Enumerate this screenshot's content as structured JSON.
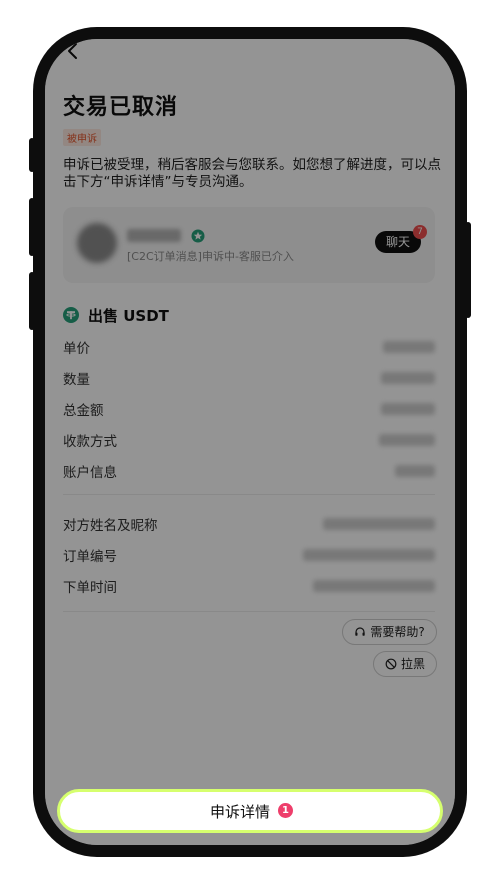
{
  "header": {
    "title": "交易已取消",
    "status_badge": "被申诉"
  },
  "description": "申诉已被受理，稍后客服会与您联系。如您想了解进度，可以点击下方“申诉详情”与专员沟通。",
  "chat_card": {
    "message_preview": "[C2C订单消息]申诉中-客服已介入",
    "chat_label": "聊天",
    "unread_count": "7"
  },
  "order": {
    "side_label": "出售 USDT",
    "fields": [
      {
        "label": "单价"
      },
      {
        "label": "数量"
      },
      {
        "label": "总金额"
      },
      {
        "label": "收款方式"
      },
      {
        "label": "账户信息"
      }
    ],
    "counterparty_fields": [
      {
        "label": "对方姓名及昵称"
      },
      {
        "label": "订单编号"
      },
      {
        "label": "下单时间"
      }
    ]
  },
  "actions": {
    "help_label": "需要帮助?",
    "block_label": "拉黑"
  },
  "bottom": {
    "appeal_label": "申诉详情",
    "appeal_count": "1"
  },
  "colors": {
    "accent_lime": "#d6ff6e",
    "badge_red": "#ee3e6b",
    "tether_green": "#26a17b"
  }
}
